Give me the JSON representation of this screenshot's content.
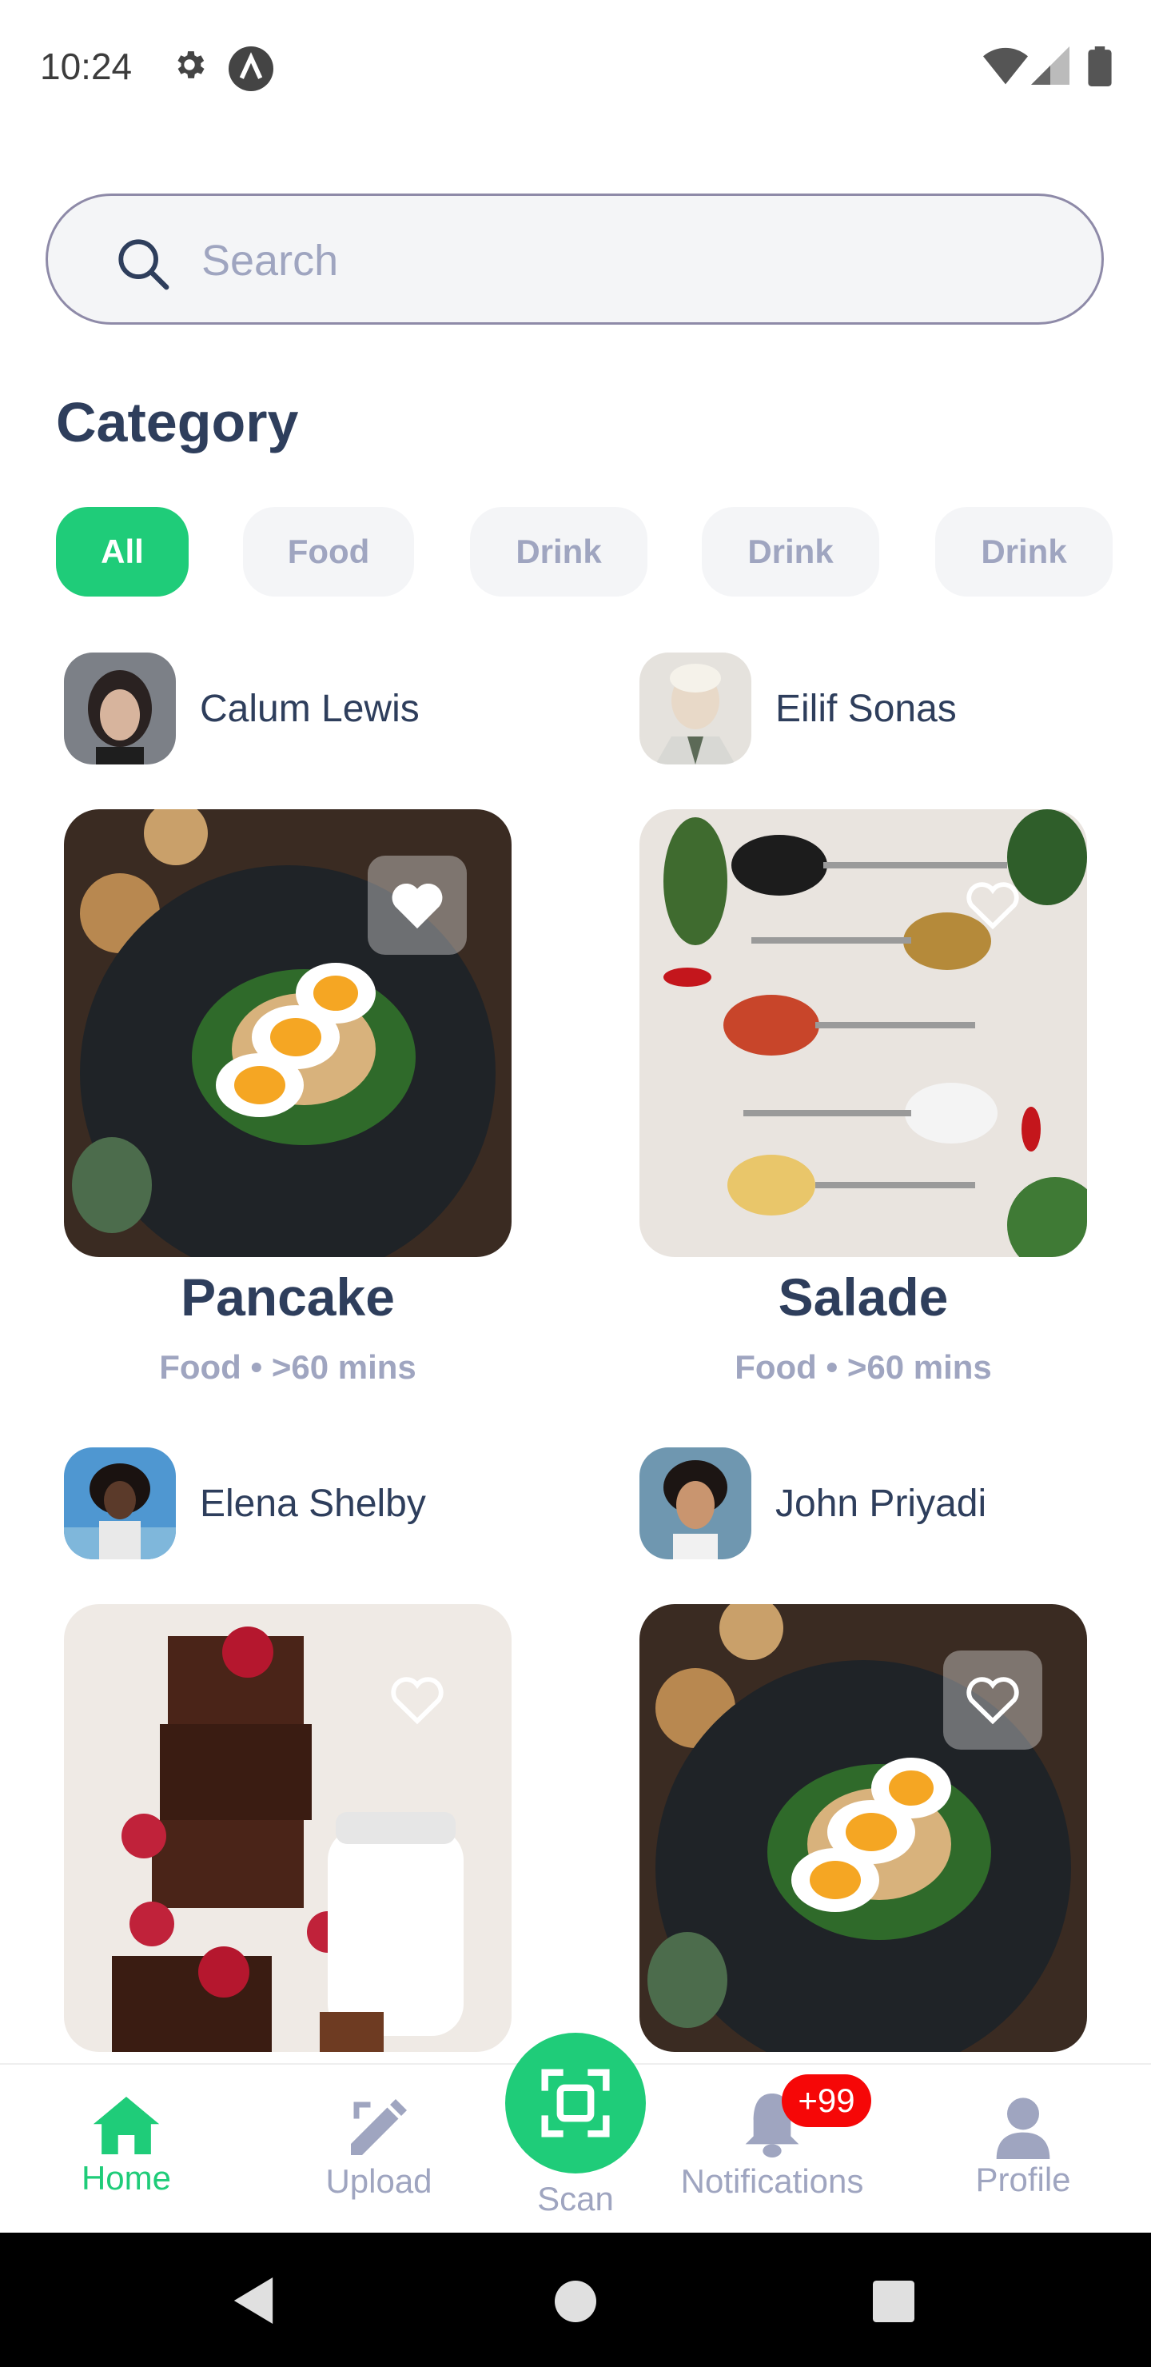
{
  "status_bar": {
    "time": "10:24",
    "icons": [
      "gear-icon",
      "app-a-icon",
      "wifi-icon",
      "signal-icon",
      "battery-icon"
    ]
  },
  "search": {
    "placeholder": "Search",
    "value": ""
  },
  "category": {
    "title": "Category",
    "chips": [
      {
        "label": "All",
        "active": true
      },
      {
        "label": "Food",
        "active": false
      },
      {
        "label": "Drink",
        "active": false
      },
      {
        "label": "Drink",
        "active": false
      },
      {
        "label": "Drink",
        "active": false
      }
    ]
  },
  "cards": [
    {
      "author": "Calum Lewis",
      "title": "Pancake",
      "meta": "Food • >60 mins",
      "favorited": true
    },
    {
      "author": "Eilif Sonas",
      "title": "Salade",
      "meta": "Food • >60 mins",
      "favorited": false
    },
    {
      "author": "Elena Shelby",
      "title": "",
      "meta": "",
      "favorited": false
    },
    {
      "author": "John Priyadi",
      "title": "",
      "meta": "",
      "favorited": true
    }
  ],
  "bottom_nav": {
    "items": [
      {
        "label": "Home",
        "icon": "home-icon",
        "active": true
      },
      {
        "label": "Upload",
        "icon": "edit-icon",
        "active": false
      },
      {
        "label": "Scan",
        "icon": "scan-icon",
        "active": false
      },
      {
        "label": "Notifications",
        "icon": "bell-icon",
        "active": false
      },
      {
        "label": "Profile",
        "icon": "person-icon",
        "active": false
      }
    ],
    "notification_badge": "+99"
  },
  "colors": {
    "primary": "#1fcc79",
    "text_main": "#2e3e5c",
    "text_secondary": "#9fa5c0",
    "badge": "#f60707"
  }
}
